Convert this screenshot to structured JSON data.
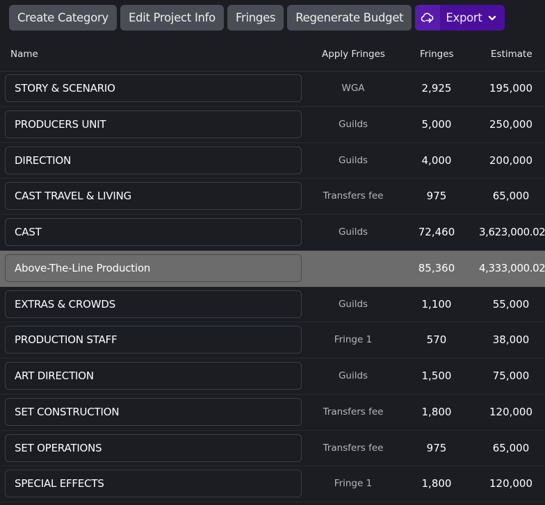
{
  "toolbar": {
    "create_category": "Create Category",
    "edit_project_info": "Edit Project Info",
    "fringes": "Fringes",
    "regenerate_budget": "Regenerate Budget",
    "export": "Export",
    "export_icon": "cloud-upload-icon",
    "export_chevron_icon": "chevron-down-icon",
    "export_color": "#4b0f9e"
  },
  "table": {
    "columns": [
      "Name",
      "Apply Fringes",
      "Fringes",
      "Estimate"
    ],
    "rows": [
      {
        "name": "STORY & SCENARIO",
        "apply_fringes": "WGA",
        "fringes": "2,925",
        "estimate": "195,000"
      },
      {
        "name": "PRODUCERS UNIT",
        "apply_fringes": "Guilds",
        "fringes": "5,000",
        "estimate": "250,000"
      },
      {
        "name": "DIRECTION",
        "apply_fringes": "Guilds",
        "fringes": "4,000",
        "estimate": "200,000"
      },
      {
        "name": "CAST TRAVEL & LIVING",
        "apply_fringes": "Transfers fee",
        "fringes": "975",
        "estimate": "65,000"
      },
      {
        "name": "CAST",
        "apply_fringes": "Guilds",
        "fringes": "72,460",
        "estimate": "3,623,000.02"
      },
      {
        "name": "Above-The-Line Production",
        "apply_fringes": "",
        "fringes": "85,360",
        "estimate": "4,333,000.02",
        "is_total": true
      },
      {
        "name": "EXTRAS & CROWDS",
        "apply_fringes": "Guilds",
        "fringes": "1,100",
        "estimate": "55,000"
      },
      {
        "name": "PRODUCTION STAFF",
        "apply_fringes": "Fringe 1",
        "fringes": "570",
        "estimate": "38,000"
      },
      {
        "name": "ART DIRECTION",
        "apply_fringes": "Guilds",
        "fringes": "1,500",
        "estimate": "75,000"
      },
      {
        "name": "SET CONSTRUCTION",
        "apply_fringes": "Transfers fee",
        "fringes": "1,800",
        "estimate": "120,000"
      },
      {
        "name": "SET OPERATIONS",
        "apply_fringes": "Transfers fee",
        "fringes": "975",
        "estimate": "65,000"
      },
      {
        "name": "SPECIAL EFFECTS",
        "apply_fringes": "Fringe 1",
        "fringes": "1,800",
        "estimate": "120,000"
      }
    ]
  }
}
